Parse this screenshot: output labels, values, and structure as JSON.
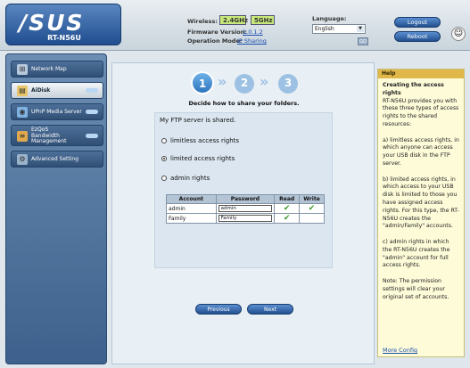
{
  "header": {
    "logo": "/SUS",
    "model": "RT-N56U",
    "wireless_label": "Wireless:",
    "band_24": "2.4GHz",
    "band_5": "5GHz",
    "firmware_label": "Firmware Version:",
    "firmware_value": "1.0.1.2",
    "opmode_label": "Operation Mode:",
    "opmode_value": "IP Sharing",
    "language_label": "Language:",
    "language_value": "English",
    "go_label": "GO",
    "logout": "Logout",
    "reboot": "Reboot"
  },
  "sidebar": {
    "items": [
      {
        "label": "Network Map"
      },
      {
        "label": "AiDisk"
      },
      {
        "label": "UPnP Media Server"
      },
      {
        "label": "EzQoS\nBandwidth\nManagement"
      },
      {
        "label": "Advanced Setting"
      }
    ]
  },
  "wizard": {
    "steps": [
      "1",
      "2",
      "3"
    ],
    "title": "Decide how to share your folders.",
    "ftp_status": "My FTP server is shared.",
    "options": [
      "limitless access rights",
      "limited access rights",
      "admin rights"
    ],
    "selected_option": 1,
    "table": {
      "headers": [
        "Account",
        "Password",
        "Read",
        "Write"
      ],
      "rows": [
        {
          "account": "admin",
          "password": "admin",
          "read": "✔",
          "write": "✔"
        },
        {
          "account": "Family",
          "password": "Family",
          "read": "✔",
          "write": ""
        }
      ]
    },
    "prev": "Previous",
    "next": "Next"
  },
  "help": {
    "title": "Help",
    "heading": "Creating the access rights",
    "body": "RT-N56U provides you with these three types of access rights to the shared resources:\n\na) limitless access rights, in which anyone can access your USB disk in the FTP server.\n\nb) limited access rights, in which access to your USB disk is limited to those you have assigned access rights. For this type, the RT-N56U creates the \"admin/Family\" accounts.\n\nc) admin rights in which the RT-N56U creates the \"admin\" account for full access rights.\n\nNote: The permission settings will clear your original set of accounts.",
    "link": "More Config"
  }
}
